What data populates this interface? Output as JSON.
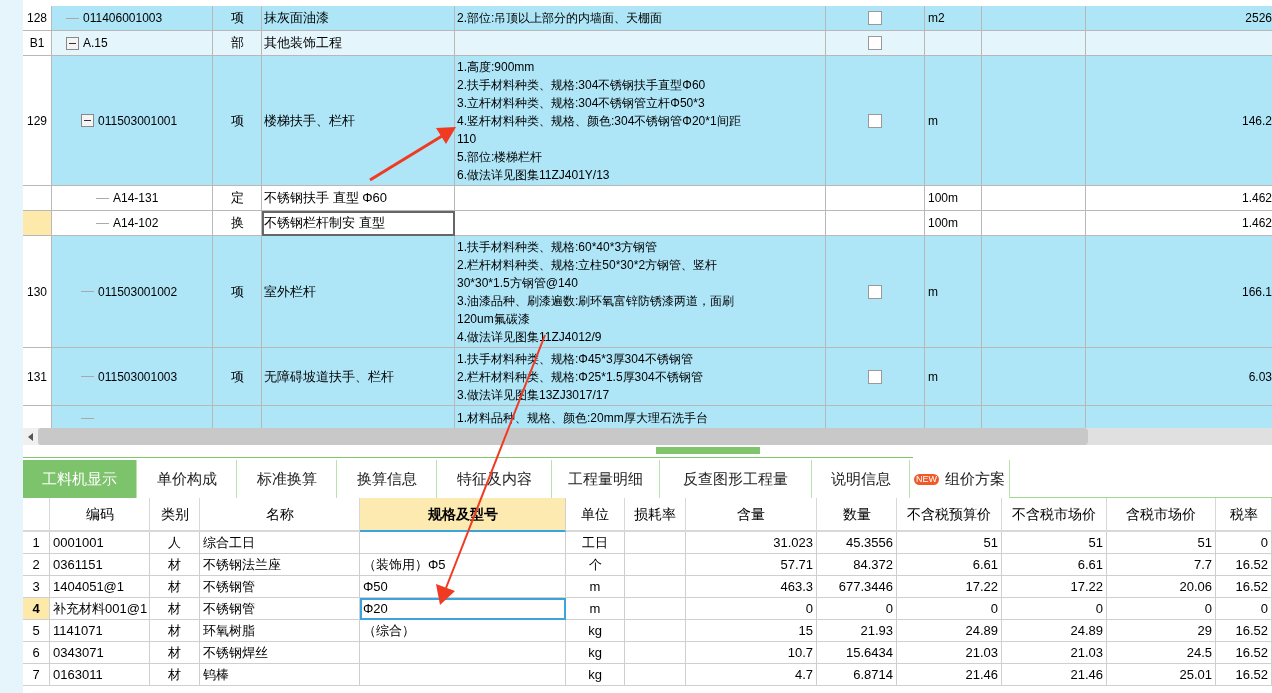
{
  "grid": {
    "rows": [
      {
        "kind": "item",
        "num": "128",
        "code": "011406001003",
        "type": "项",
        "name": "抹灰面油漆",
        "description": [
          "2.部位:吊顶以上部分的内墙面、天棚面"
        ],
        "checked": false,
        "unit": "m2",
        "quantity": "2526",
        "selected": false
      },
      {
        "kind": "section",
        "num": "B1",
        "code": "A.15",
        "type": "部",
        "name": "其他装饰工程",
        "checked": false,
        "expanded": true,
        "selected": false,
        "children": [
          {
            "kind": "item",
            "num": "129",
            "code": "011503001001",
            "type": "项",
            "name": "楼梯扶手、栏杆",
            "description": [
              "1.高度:900mm",
              "2.扶手材料种类、规格:304不锈钢扶手直型Φ60",
              "3.立杆材料种类、规格:304不锈钢管立杆Φ50*3",
              "4.竖杆材料种类、规格、颜色:304不锈钢管Φ20*1间距",
              "110",
              "5.部位:楼梯栏杆",
              "6.做法详见图集11ZJ401Y/13"
            ],
            "checked": false,
            "unit": "m",
            "quantity": "146.2",
            "expanded": true,
            "selected": false,
            "children": [
              {
                "kind": "quota",
                "code": "A14-131",
                "type": "定",
                "name": "不锈钢扶手 直型 Φ60",
                "unit": "100m",
                "quantity": "1.462",
                "selected": false
              },
              {
                "kind": "quota",
                "code": "A14-102",
                "type": "换",
                "name": "不锈钢栏杆制安 直型",
                "unit": "100m",
                "quantity": "1.462",
                "selected": true
              }
            ]
          },
          {
            "kind": "item",
            "num": "130",
            "code": "011503001002",
            "type": "项",
            "name": "室外栏杆",
            "description": [
              "1.扶手材料种类、规格:60*40*3方钢管",
              "2.栏杆材料种类、规格:立柱50*30*2方钢管、竖杆",
              "30*30*1.5方钢管@140",
              "3.油漆品种、刷漆遍数:刷环氧富锌防锈漆两道，面刷",
              "120um氟碳漆",
              "4.做法详见图集11ZJ4012/9"
            ],
            "checked": false,
            "unit": "m",
            "quantity": "166.1",
            "selected": false
          },
          {
            "kind": "item",
            "num": "131",
            "code": "011503001003",
            "type": "项",
            "name": "无障碍坡道扶手、栏杆",
            "description": [
              "1.扶手材料种类、规格:Φ45*3厚304不锈钢管",
              "2.栏杆材料种类、规格:Φ25*1.5厚304不锈钢管",
              "3.做法详见图集13ZJ3017/17"
            ],
            "checked": false,
            "unit": "m",
            "quantity": "6.03",
            "selected": false
          },
          {
            "kind": "item",
            "description": [
              "1.材料品种、规格、颜色:20mm厚大理石洗手台"
            ],
            "selected": false
          }
        ]
      }
    ]
  },
  "tabs": [
    {
      "label": "工料机显示",
      "selected": true
    },
    {
      "label": "单价构成",
      "selected": false
    },
    {
      "label": "标准换算",
      "selected": false
    },
    {
      "label": "换算信息",
      "selected": false
    },
    {
      "label": "特征及内容",
      "selected": false
    },
    {
      "label": "工程量明细",
      "selected": false
    },
    {
      "label": "反查图形工程量",
      "selected": false
    },
    {
      "label": "说明信息",
      "selected": false
    },
    {
      "label": "组价方案",
      "selected": false,
      "badge": "NEW"
    }
  ],
  "materials": {
    "columns": [
      {
        "selected": false
      },
      {
        "label": "编码",
        "selected": false
      },
      {
        "label": "类别",
        "selected": false
      },
      {
        "label": "名称",
        "selected": false
      },
      {
        "label": "规格及型号",
        "selected": true
      },
      {
        "label": "单位",
        "selected": false
      },
      {
        "label": "损耗率",
        "selected": false
      },
      {
        "label": "含量",
        "selected": false
      },
      {
        "label": "数量",
        "selected": false
      },
      {
        "label": "不含税预算价",
        "selected": false
      },
      {
        "label": "不含税市场价",
        "selected": false
      },
      {
        "label": "含税市场价",
        "selected": false
      },
      {
        "label": "税率",
        "selected": false
      }
    ],
    "rows": [
      {
        "selected": false,
        "cells": [
          "1",
          "0001001",
          "人",
          "综合工日",
          "",
          "工日",
          "",
          "31.023",
          "45.3556",
          "51",
          "51",
          "51",
          "0"
        ]
      },
      {
        "selected": false,
        "cells": [
          "2",
          "0361151",
          "材",
          "不锈钢法兰座",
          "（装饰用）Φ5",
          "个",
          "",
          "57.71",
          "84.372",
          "6.61",
          "6.61",
          "7.7",
          "16.52"
        ]
      },
      {
        "selected": false,
        "cells": [
          "3",
          "1404051@1",
          "材",
          "不锈钢管",
          "Φ50",
          "m",
          "",
          "463.3",
          "677.3446",
          "17.22",
          "17.22",
          "20.06",
          "16.52"
        ]
      },
      {
        "selected": true,
        "cells": [
          "4",
          "补充材料001@1",
          "材",
          "不锈钢管",
          "Φ20",
          "m",
          "",
          "0",
          "0",
          "0",
          "0",
          "0",
          "0"
        ]
      },
      {
        "selected": false,
        "cells": [
          "5",
          "1141071",
          "材",
          "环氧树脂",
          "（综合）",
          "kg",
          "",
          "15",
          "21.93",
          "24.89",
          "24.89",
          "29",
          "16.52"
        ]
      },
      {
        "selected": false,
        "cells": [
          "6",
          "0343071",
          "材",
          "不锈钢焊丝",
          "",
          "kg",
          "",
          "10.7",
          "15.6434",
          "21.03",
          "21.03",
          "24.5",
          "16.52"
        ]
      },
      {
        "selected": false,
        "cells": [
          "7",
          "0163011",
          "材",
          "钨棒",
          "",
          "kg",
          "",
          "4.7",
          "6.8714",
          "21.46",
          "21.46",
          "25.01",
          "16.52"
        ]
      }
    ]
  }
}
